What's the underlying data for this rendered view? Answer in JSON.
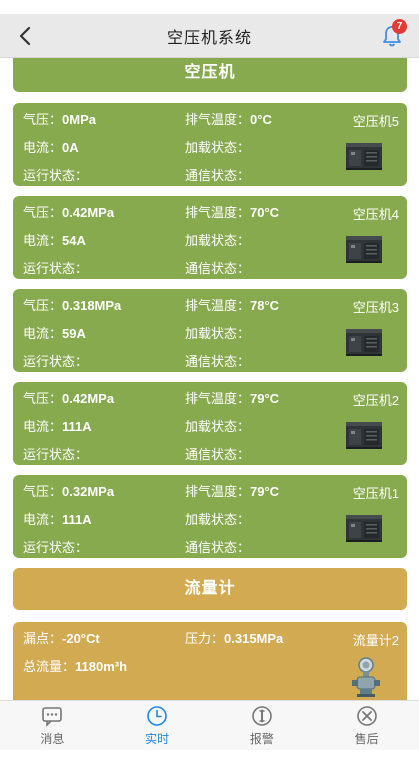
{
  "header": {
    "title": "空压机系统",
    "notification_count": "7"
  },
  "sections": {
    "compressor_title": "空压机",
    "flow_title": "流量计"
  },
  "labels": {
    "pressure": "气压：",
    "exhaust_temp": "排气温度：",
    "current": "电流：",
    "load_status": "加载状态：",
    "run_status": "运行状态：",
    "comm_status": "通信状态："
  },
  "compressors": [
    {
      "name": "空压机5",
      "pressure": "0MPa",
      "exhaust_temp": "0°C",
      "current": "0A",
      "load_status": "",
      "run_status": "",
      "comm_status": ""
    },
    {
      "name": "空压机4",
      "pressure": "0.42MPa",
      "exhaust_temp": "70°C",
      "current": "54A",
      "load_status": "",
      "run_status": "",
      "comm_status": ""
    },
    {
      "name": "空压机3",
      "pressure": "0.318MPa",
      "exhaust_temp": "78°C",
      "current": "59A",
      "load_status": "",
      "run_status": "",
      "comm_status": ""
    },
    {
      "name": "空压机2",
      "pressure": "0.42MPa",
      "exhaust_temp": "79°C",
      "current": "111A",
      "load_status": "",
      "run_status": "",
      "comm_status": ""
    },
    {
      "name": "空压机1",
      "pressure": "0.32MPa",
      "exhaust_temp": "79°C",
      "current": "111A",
      "load_status": "",
      "run_status": "",
      "comm_status": ""
    }
  ],
  "flowmeter": {
    "name": "流量计2",
    "dew_label": "漏点：",
    "dew_value": "-20°Ct",
    "pressure_label": "压力：",
    "pressure_value": "0.315MPa",
    "total_label": "总流量：",
    "total_value": "1180m³h"
  },
  "tabs": [
    {
      "label": "消息",
      "icon": "message-icon"
    },
    {
      "label": "实时",
      "icon": "clock-icon"
    },
    {
      "label": "报警",
      "icon": "alarm-icon"
    },
    {
      "label": "售后",
      "icon": "tools-icon"
    }
  ],
  "colors": {
    "green": "#88aa4f",
    "gold": "#d2aa52",
    "active_tab": "#1e88e5",
    "badge": "#e53935"
  }
}
